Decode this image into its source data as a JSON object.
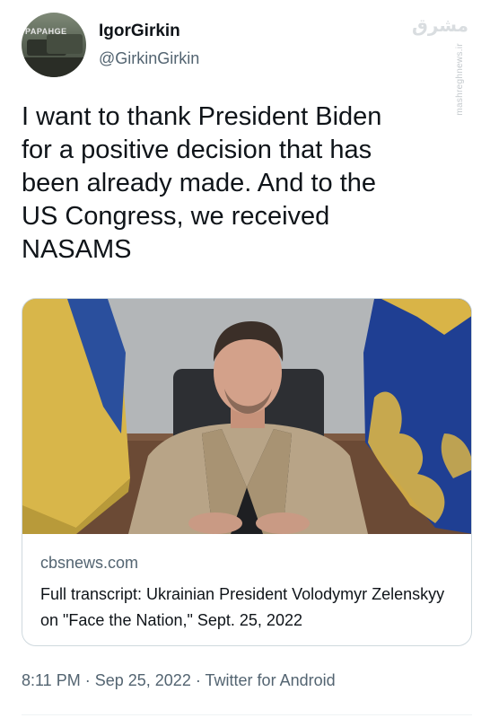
{
  "author": {
    "display_name": "IgorGirkin",
    "handle": "@GirkinGirkin",
    "avatar_text": "PAPAHGE"
  },
  "watermark": {
    "logo": "مشرق",
    "site": "mashreghnews.ir"
  },
  "tweet": {
    "text": "I want to thank President Biden\nfor a positive decision that has\nbeen already made. And to the\nUS Congress, we received\nNASAMS"
  },
  "link_card": {
    "domain": "cbsnews.com",
    "title": "Full transcript: Ukrainian President Volodymyr Zelenskyy on \"Face the Nation,\" Sept. 25, 2022",
    "image_description_icon": "news-photo"
  },
  "meta": {
    "time": "8:11 PM",
    "separator": "·",
    "date": "Sep 25, 2022",
    "source": "Twitter for Android"
  },
  "colors": {
    "text_primary": "#0f1419",
    "text_secondary": "#536471",
    "border": "#cfd9de"
  }
}
